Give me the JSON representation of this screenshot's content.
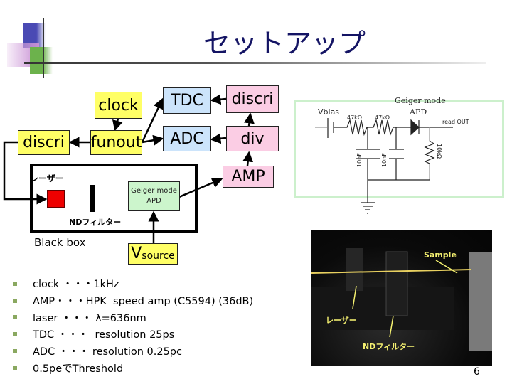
{
  "slide": {
    "title": "セットアップ",
    "page_number": "6"
  },
  "diagram": {
    "boxes": {
      "clock": "clock",
      "funout": "funout",
      "discri_left": "discri",
      "tdc": "TDC",
      "adc": "ADC",
      "discri_right": "discri",
      "div": "div",
      "amp": "AMP",
      "apd": "Geiger mode\nAPD",
      "vsource_main": "V",
      "vsource_sub": "source"
    },
    "labels": {
      "laser": "レーザー",
      "nd_filter": "NDフィルター",
      "black_box": "Black box"
    }
  },
  "circuit": {
    "title_line1": "Geiger mode",
    "title_line2": "APD",
    "vbias": "Vbias",
    "r1": "47kΩ",
    "r2": "47kΩ",
    "c1": "10nF",
    "c2": "10nF",
    "r_load": "10kΩ",
    "readout": "read OUT"
  },
  "bullets": [
    "clock ・・・1kHz",
    "AMP・・・HPK  speed amp (C5594) (36dB)",
    "laser ・・・ λ=636nm",
    "TDC ・・・  resolution 25ps",
    "ADC ・・・ resolution 0.25pc",
    "0.5peでThreshold"
  ],
  "photo": {
    "labels": {
      "sample": "Sample",
      "laser": "レーザー",
      "nd_filter": "NDフィルター"
    }
  },
  "colors": {
    "title": "#141464",
    "yellow_box": "#ffff66",
    "blue_box": "#cce4fb",
    "pink_box": "#fbcde4",
    "green_box": "#ccf5cc",
    "laser": "#ee0000",
    "bullet": "#8aa860",
    "photo_label": "#f4f070"
  }
}
